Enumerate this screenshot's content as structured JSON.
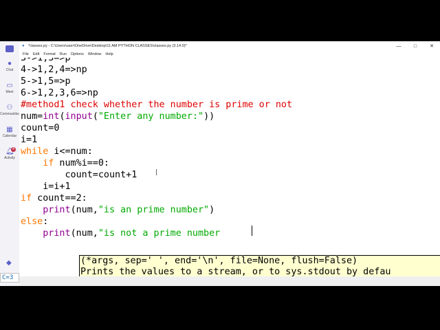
{
  "window": {
    "title": "*classes.py - C:\\Users\\user\\OneDrive\\Desktop\\11 AM PYTHON CLASSES\\classes.py (3.14.0)*",
    "controls": {
      "minimize": "—",
      "maximize": "□",
      "close": "✕"
    }
  },
  "menu": [
    "File",
    "Edit",
    "Format",
    "Run",
    "Options",
    "Window",
    "Help"
  ],
  "sidebar": {
    "items": [
      {
        "label": "Chat",
        "icon": "chat-icon"
      },
      {
        "label": "Meet",
        "icon": "video-icon"
      },
      {
        "label": "Communities",
        "icon": "communities-icon"
      },
      {
        "label": "Calendar",
        "icon": "calendar-icon"
      },
      {
        "label": "Activity",
        "icon": "bell-icon",
        "badge": "4"
      }
    ],
    "shell_prompt": "C=3"
  },
  "code": [
    "3->1,3=>p",
    "4->1,2,4=>np",
    "5->1,5=>p",
    "6->1,2,3,6=>np",
    "#method1 check whether the number is prime or not",
    "num=int(input(\"Enter any number:\"))",
    "count=0",
    "i=1",
    "while i<=num:",
    "    if num%i==0:",
    "        count=count+1",
    "    i=i+1",
    "if count==2:",
    "    print(num,\"is an prime number\")",
    "else:",
    "    print(num,\"is not a prime number"
  ],
  "calltip": {
    "signature": "(*args, sep=' ', end='\\n', file=None, flush=False)",
    "doc": "Prints the values to a stream, or to sys.stdout by defau"
  },
  "colors": {
    "keyword": "#ff7700",
    "builtin": "#900090",
    "string": "#00aa00",
    "comment": "#dd0000",
    "teams_accent": "#5b5fc7"
  }
}
